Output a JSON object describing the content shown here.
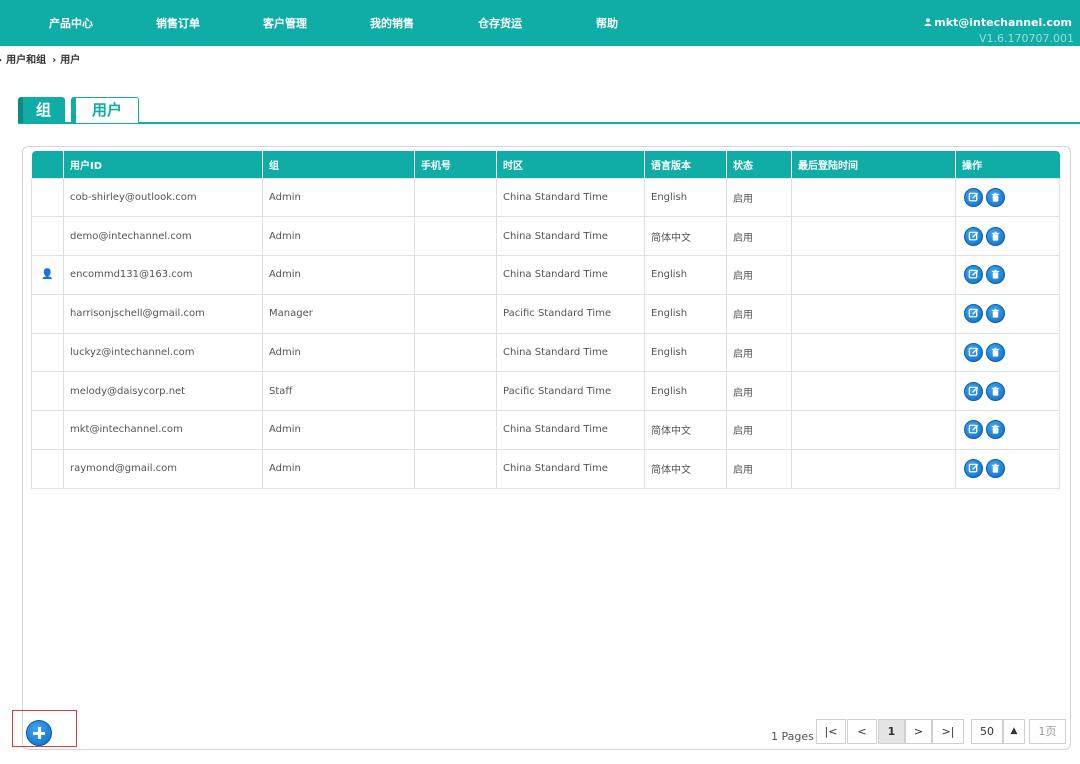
{
  "nav": {
    "items": [
      "产品中心",
      "销售订单",
      "客户管理",
      "我的销售",
      "仓存货运",
      "帮助"
    ],
    "user": "mkt@intechannel.com",
    "version": "V1.6.170707.001"
  },
  "breadcrumb": {
    "items": [
      "用户和组",
      "用户"
    ]
  },
  "tabs": {
    "group": "组",
    "user": "用户"
  },
  "table": {
    "headers": [
      "用户ID",
      "组",
      "手机号",
      "时区",
      "语言版本",
      "状态",
      "最后登陆时间",
      "操作"
    ],
    "rows": [
      {
        "marker": "",
        "user_id": "cob-shirley@outlook.com",
        "group": "Admin",
        "phone": "",
        "timezone": "China Standard Time",
        "language": "English",
        "status": "启用",
        "last_login": ""
      },
      {
        "marker": "",
        "user_id": "demo@intechannel.com",
        "group": "Admin",
        "phone": "",
        "timezone": "China Standard Time",
        "language": "简体中文",
        "status": "启用",
        "last_login": ""
      },
      {
        "marker": "👤",
        "user_id": "encommd131@163.com",
        "group": "Admin",
        "phone": "",
        "timezone": "China Standard Time",
        "language": "English",
        "status": "启用",
        "last_login": ""
      },
      {
        "marker": "",
        "user_id": "harrisonjschell@gmail.com",
        "group": "Manager",
        "phone": "",
        "timezone": "Pacific Standard Time",
        "language": "English",
        "status": "启用",
        "last_login": ""
      },
      {
        "marker": "",
        "user_id": "luckyz@intechannel.com",
        "group": "Admin",
        "phone": "",
        "timezone": "China Standard Time",
        "language": "English",
        "status": "启用",
        "last_login": ""
      },
      {
        "marker": "",
        "user_id": "melody@daisycorp.net",
        "group": "Staff",
        "phone": "",
        "timezone": "Pacific Standard Time",
        "language": "English",
        "status": "启用",
        "last_login": ""
      },
      {
        "marker": "",
        "user_id": "mkt@intechannel.com",
        "group": "Admin",
        "phone": "",
        "timezone": "China Standard Time",
        "language": "简体中文",
        "status": "启用",
        "last_login": ""
      },
      {
        "marker": "",
        "user_id": "raymond@gmail.com",
        "group": "Admin",
        "phone": "",
        "timezone": "China Standard Time",
        "language": "简体中文",
        "status": "启用",
        "last_login": ""
      }
    ]
  },
  "pager": {
    "pages_label": "1 Pages",
    "first": "|<",
    "prev": "<",
    "current": "1",
    "next": ">",
    "last": ">|",
    "page_size": "50",
    "size_toggle": "▲",
    "page_jump": "1页"
  },
  "colors": {
    "accent": "#0fada5",
    "icon_blue": "#1a82d9",
    "add_highlight": "#e53935"
  }
}
